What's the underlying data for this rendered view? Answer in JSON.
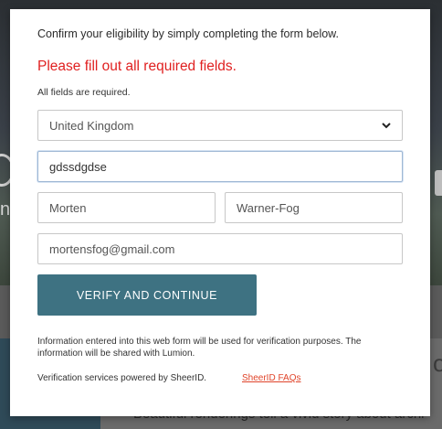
{
  "background": {
    "left_fragment": "n",
    "right_fragment": "o",
    "bottom_text": "Beautiful renderings tell a vivid story about archi"
  },
  "form": {
    "intro": "Confirm your eligibility by simply completing the form below.",
    "error": "Please fill out all required fields.",
    "required_note": "All fields are required.",
    "country": {
      "value": "United Kingdom",
      "icon": "chevron-down-icon"
    },
    "organization": {
      "value": "gdssdgdse"
    },
    "first_name": {
      "value": "Morten"
    },
    "last_name": {
      "value": "Warner-Fog"
    },
    "email": {
      "value": "mortensfog@gmail.com"
    },
    "submit_label": "VERIFY AND CONTINUE",
    "disclaimer": "Information entered into this web form will be used for verification purposes. The information will be shared with Lumion.",
    "powered_by": "Verification services powered by SheerID.",
    "faq_link": "SheerID FAQs"
  },
  "colors": {
    "error": "#e02020",
    "button": "#3e7282",
    "link": "#e0442a"
  }
}
